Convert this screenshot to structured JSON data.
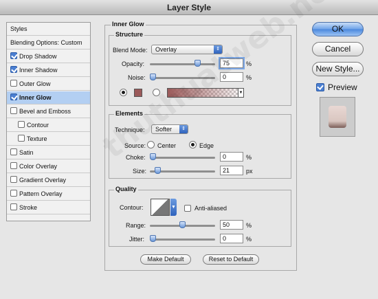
{
  "window": {
    "title": "Layer Style"
  },
  "sidebar": {
    "items": [
      {
        "label": "Styles",
        "checkbox": null
      },
      {
        "label": "Blending Options: Custom",
        "checkbox": null
      },
      {
        "label": "Drop Shadow",
        "checkbox": true
      },
      {
        "label": "Inner Shadow",
        "checkbox": true
      },
      {
        "label": "Outer Glow",
        "checkbox": false
      },
      {
        "label": "Inner Glow",
        "checkbox": true,
        "selected": true
      },
      {
        "label": "Bevel and Emboss",
        "checkbox": false
      },
      {
        "label": "Contour",
        "checkbox": false,
        "indent": true
      },
      {
        "label": "Texture",
        "checkbox": false,
        "indent": true
      },
      {
        "label": "Satin",
        "checkbox": false
      },
      {
        "label": "Color Overlay",
        "checkbox": false
      },
      {
        "label": "Gradient Overlay",
        "checkbox": false
      },
      {
        "label": "Pattern Overlay",
        "checkbox": false
      },
      {
        "label": "Stroke",
        "checkbox": false
      }
    ]
  },
  "inner_glow": {
    "title": "Inner Glow",
    "structure": {
      "title": "Structure",
      "blend_mode_label": "Blend Mode:",
      "blend_mode": "Overlay",
      "opacity_label": "Opacity:",
      "opacity": "75",
      "opacity_level": 0.75,
      "noise_label": "Noise:",
      "noise": "0",
      "noise_level": 0,
      "percent": "%",
      "glow_color": "#9b5a5a",
      "color_mode": "solid"
    },
    "elements": {
      "title": "Elements",
      "technique_label": "Technique:",
      "technique": "Softer",
      "source_label": "Source:",
      "source_center": "Center",
      "source_edge": "Edge",
      "source_selected": "Edge",
      "choke_label": "Choke:",
      "choke": "0",
      "choke_level": 0,
      "size_label": "Size:",
      "size": "21",
      "size_unit": "px",
      "size_level": 0.084,
      "percent": "%"
    },
    "quality": {
      "title": "Quality",
      "contour_label": "Contour:",
      "anti_aliased_label": "Anti-aliased",
      "anti_aliased": false,
      "range_label": "Range:",
      "range": "50",
      "range_level": 0.5,
      "jitter_label": "Jitter:",
      "jitter": "0",
      "jitter_level": 0,
      "percent": "%"
    },
    "make_default": "Make Default",
    "reset_to_default": "Reset to Default"
  },
  "buttons": {
    "ok": "OK",
    "cancel": "Cancel",
    "new_style": "New Style...",
    "preview_label": "Preview",
    "preview_checked": true
  },
  "watermark": "thuthuatweb.net",
  "colors": {
    "accent": "#4a88dd",
    "selection": "#b3cff2",
    "glow": "#9b5a5a"
  }
}
